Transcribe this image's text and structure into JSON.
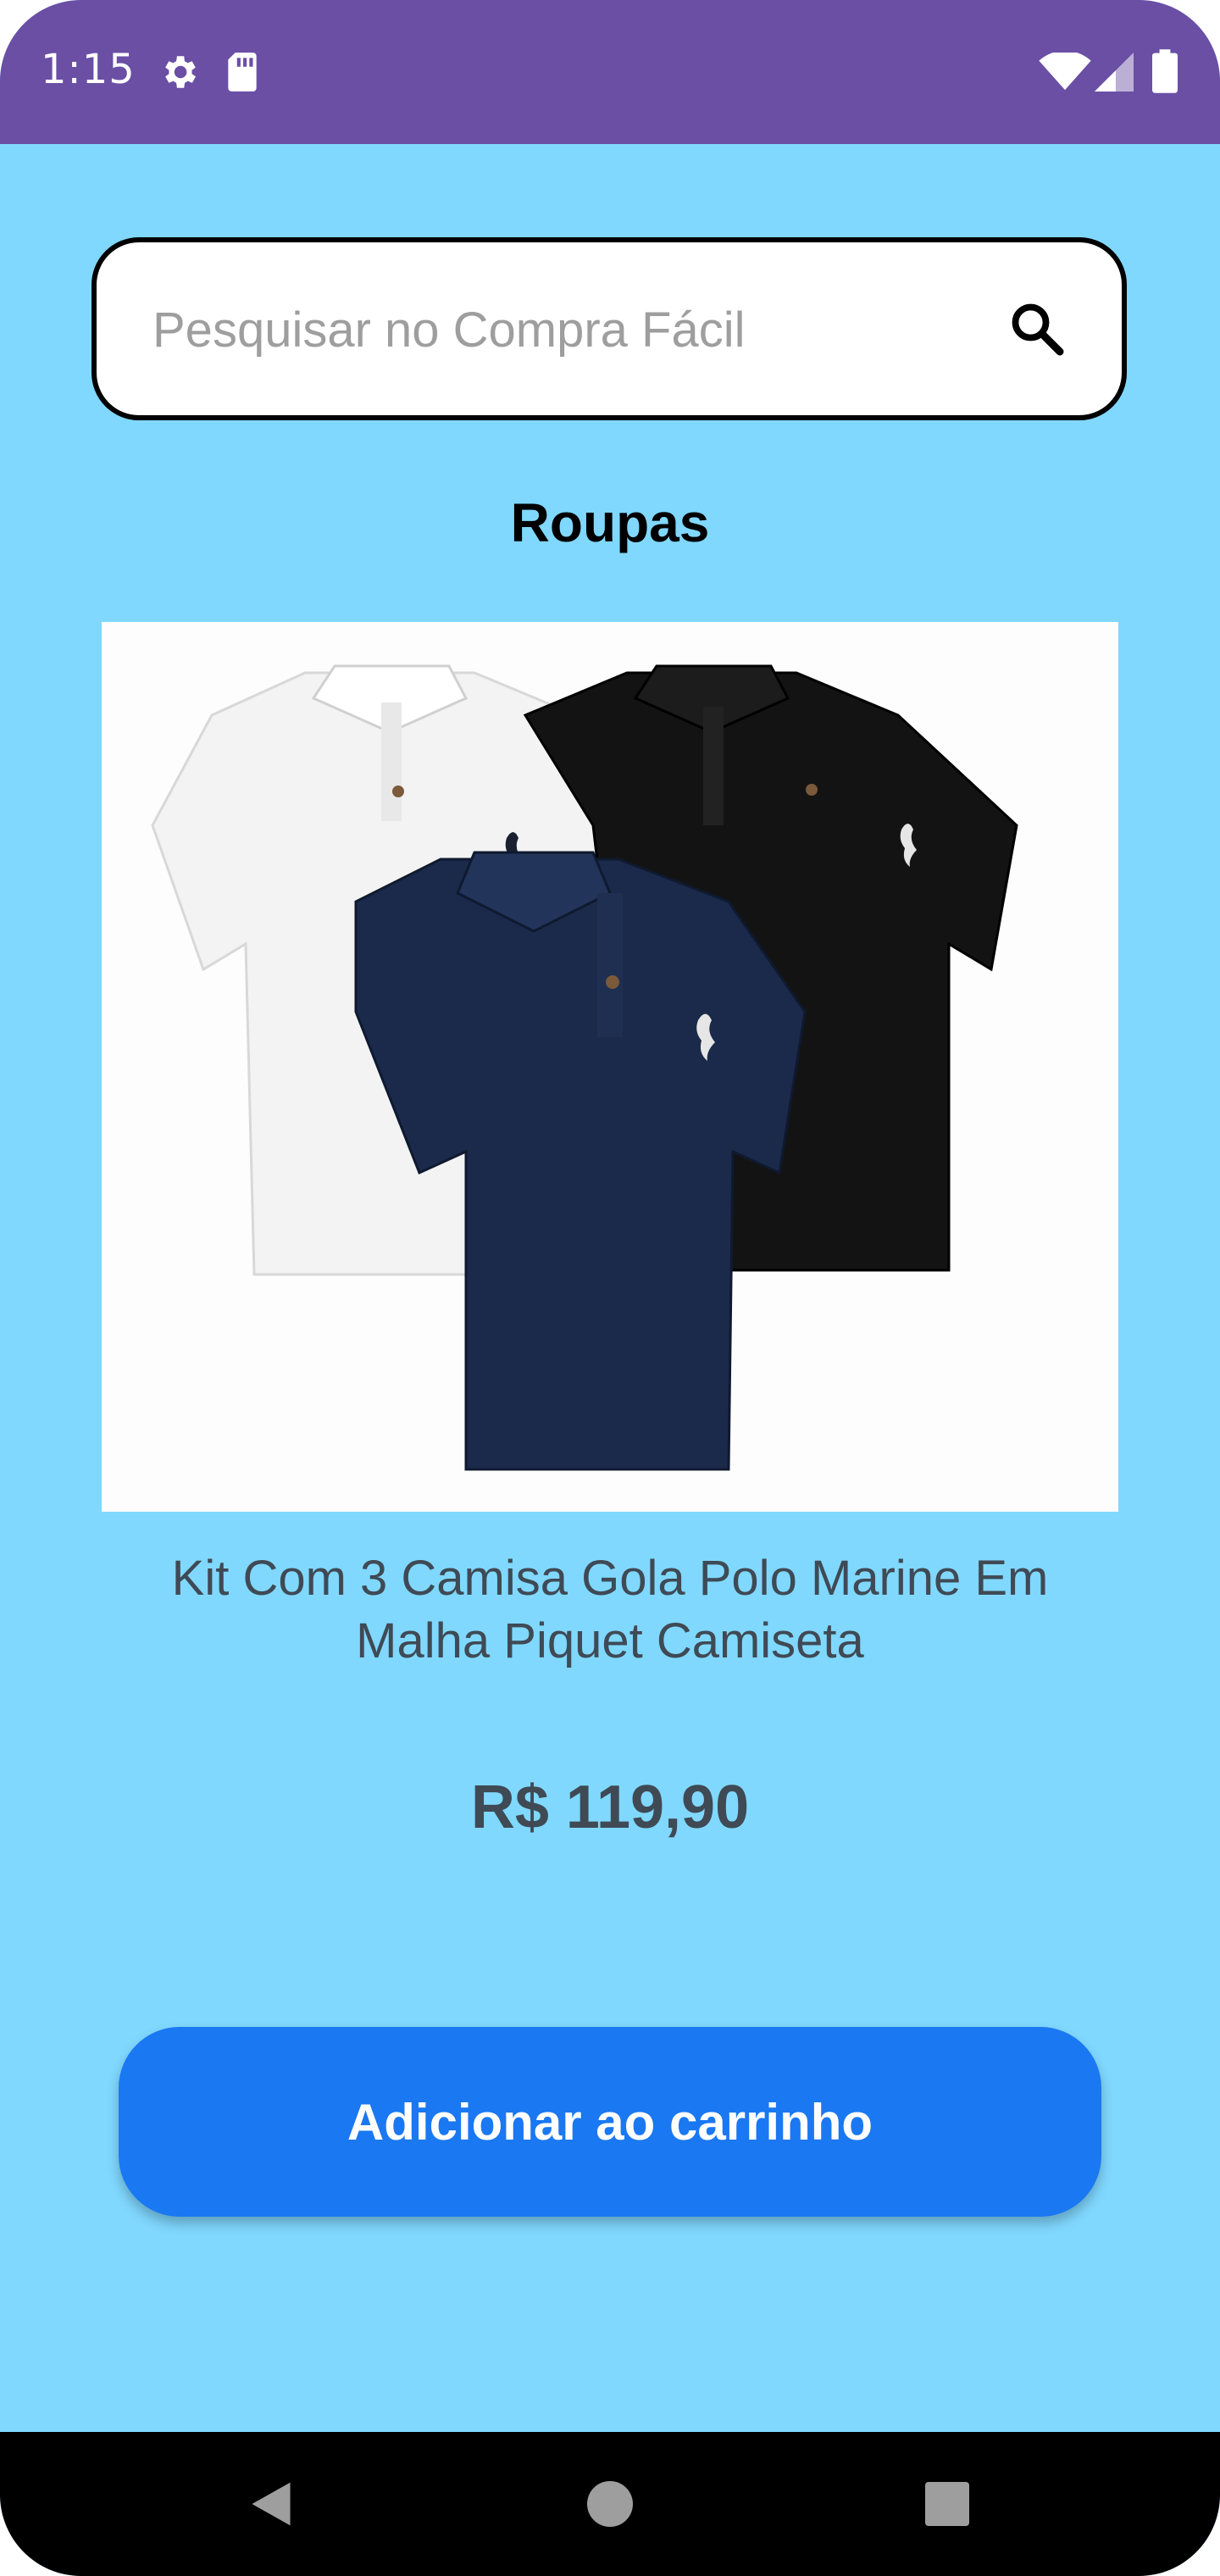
{
  "status_bar": {
    "time": "1:15",
    "icons": [
      "gear-icon",
      "sd-card-icon",
      "wifi-icon",
      "signal-icon",
      "battery-icon"
    ]
  },
  "search": {
    "placeholder": "Pesquisar no Compra Fácil",
    "value": "",
    "icon": "search-icon"
  },
  "category": {
    "title": "Roupas"
  },
  "product": {
    "image": "three-polo-shirts-image",
    "name": "Kit Com 3 Camisa Gola Polo Marine Em Malha Piquet Camiseta",
    "price": "R$ 119,90"
  },
  "actions": {
    "add_to_cart_label": "Adicionar ao carrinho"
  },
  "nav_bar": {
    "icons": [
      "back-icon",
      "home-icon",
      "recents-icon"
    ]
  },
  "colors": {
    "status_bar": "#6a4fa5",
    "background": "#80d8ff",
    "button": "#1a78f2",
    "text_secondary": "#3f4a55"
  }
}
